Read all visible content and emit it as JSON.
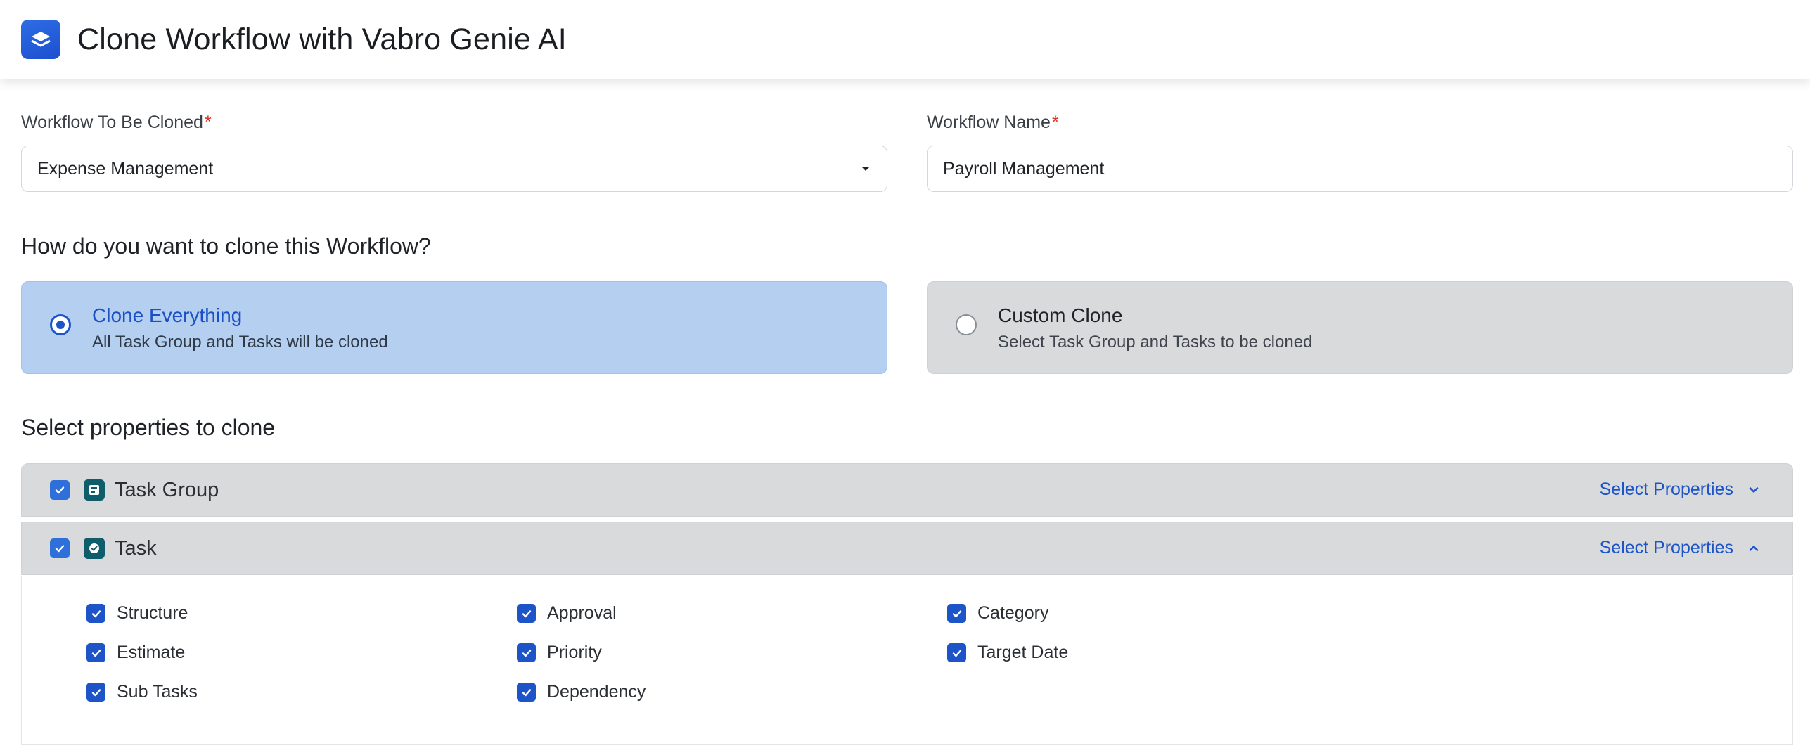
{
  "header": {
    "title": "Clone Workflow with Vabro Genie AI",
    "logo_icon": "stack-layers-icon",
    "accent": "#2f6de6"
  },
  "form": {
    "source_workflow": {
      "label": "Workflow To Be Cloned",
      "required_mark": "*",
      "value": "Expense Management"
    },
    "workflow_name": {
      "label": "Workflow Name",
      "required_mark": "*",
      "value": "Payroll Management"
    }
  },
  "clone_method": {
    "heading": "How do you want to clone this Workflow?",
    "options": [
      {
        "title": "Clone Everything",
        "subtitle": "All Task Group and Tasks will be cloned",
        "selected": true
      },
      {
        "title": "Custom Clone",
        "subtitle": "Select Task Group and Tasks to be cloned",
        "selected": false
      }
    ]
  },
  "properties": {
    "heading": "Select properties to clone",
    "groups": [
      {
        "label": "Task Group",
        "checked": true,
        "icon": "task-group-icon",
        "action": "Select Properties",
        "expanded": false
      },
      {
        "label": "Task",
        "checked": true,
        "icon": "task-check-icon",
        "action": "Select Properties",
        "expanded": true
      }
    ],
    "task_properties": [
      "Structure",
      "Approval",
      "Category",
      "Estimate",
      "Priority",
      "Target Date",
      "Sub Tasks",
      "Dependency"
    ]
  },
  "colors": {
    "selected_card": "#b4cff0",
    "unselected_card": "#d9dadc",
    "link": "#1d55c9",
    "checkbox": "#1d55c9",
    "required": "#d93025"
  }
}
